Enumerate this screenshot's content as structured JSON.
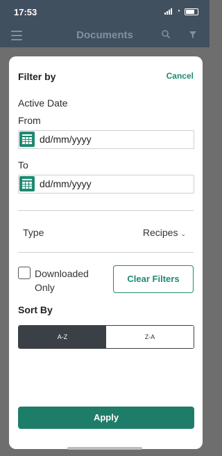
{
  "status": {
    "time": "17:53"
  },
  "app_bar": {
    "title": "Documents"
  },
  "filter": {
    "title": "Filter by",
    "cancel": "Cancel",
    "active_date": "Active Date",
    "from_label": "From",
    "to_label": "To",
    "from_value": "dd/mm/yyyy",
    "to_value": "dd/mm/yyyy",
    "type_label": "Type",
    "type_value": "Recipes",
    "downloaded_label": "Downloaded Only",
    "clear_filters": "Clear Filters",
    "sort_title": "Sort By",
    "sort_options": [
      "A-Z",
      "Z-A"
    ],
    "apply": "Apply"
  },
  "colors": {
    "accent": "#1f8a70",
    "header": "#41505f",
    "active_segment": "#3a4045"
  },
  "icons": [
    "menu-icon",
    "search-icon",
    "filter-icon",
    "calendar-icon",
    "chevron-down-icon"
  ]
}
